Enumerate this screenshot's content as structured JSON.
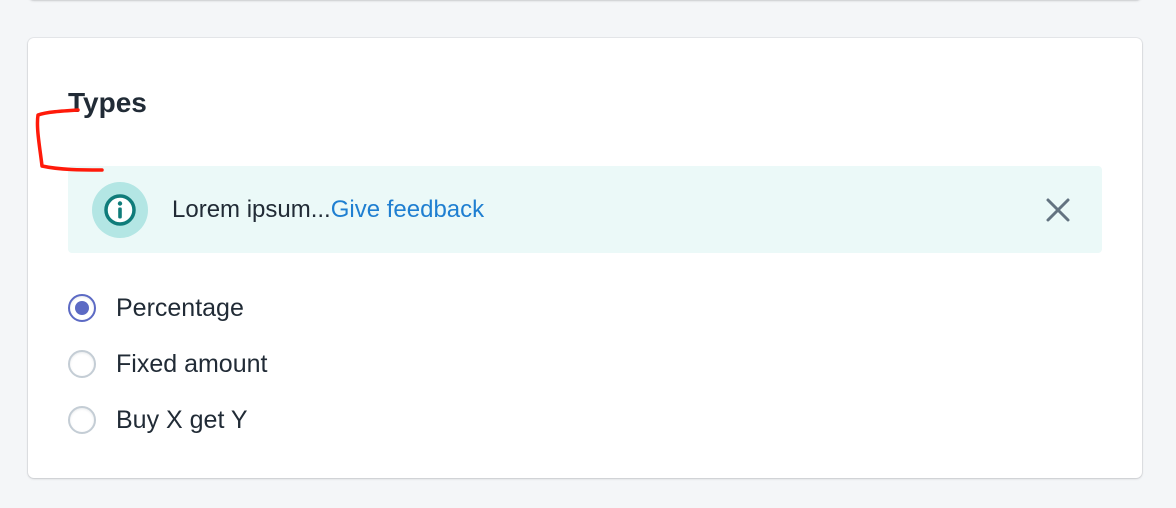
{
  "card": {
    "title": "Types"
  },
  "banner": {
    "message": "Lorem ipsum...",
    "link_label": "Give feedback",
    "icon": "info-icon",
    "close_icon": "close-icon"
  },
  "discount_types": {
    "options": [
      {
        "label": "Percentage",
        "checked": true
      },
      {
        "label": "Fixed amount",
        "checked": false
      },
      {
        "label": "Buy X get Y",
        "checked": false
      }
    ]
  },
  "colors": {
    "accent": "#5c6ac4",
    "link": "#1f7fd1",
    "banner_bg": "#ebf9f8",
    "banner_icon": "#0f7c7a",
    "annotation": "#ff0000"
  }
}
